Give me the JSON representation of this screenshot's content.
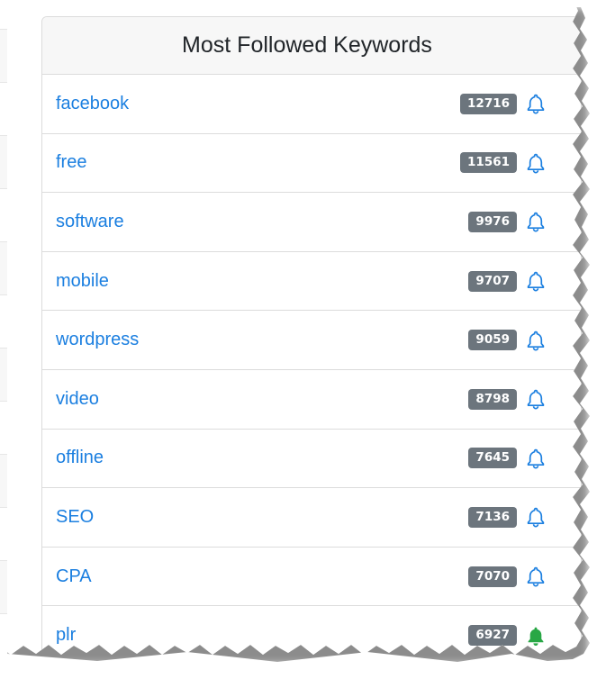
{
  "card": {
    "title": "Most Followed Keywords"
  },
  "keywords": [
    {
      "label": "facebook",
      "count": "12716",
      "bell_state": "outline",
      "bell_color": "#1b7fe0"
    },
    {
      "label": "free",
      "count": "11561",
      "bell_state": "outline",
      "bell_color": "#1b7fe0"
    },
    {
      "label": "software",
      "count": "9976",
      "bell_state": "outline",
      "bell_color": "#1b7fe0"
    },
    {
      "label": "mobile",
      "count": "9707",
      "bell_state": "outline",
      "bell_color": "#1b7fe0"
    },
    {
      "label": "wordpress",
      "count": "9059",
      "bell_state": "outline",
      "bell_color": "#1b7fe0"
    },
    {
      "label": "video",
      "count": "8798",
      "bell_state": "outline",
      "bell_color": "#1b7fe0"
    },
    {
      "label": "offline",
      "count": "7645",
      "bell_state": "outline",
      "bell_color": "#1b7fe0"
    },
    {
      "label": "SEO",
      "count": "7136",
      "bell_state": "outline",
      "bell_color": "#1b7fe0"
    },
    {
      "label": "CPA",
      "count": "7070",
      "bell_state": "outline",
      "bell_color": "#1b7fe0"
    },
    {
      "label": "plr",
      "count": "6927",
      "bell_state": "filled",
      "bell_color": "#28a745"
    }
  ],
  "icons": {
    "bell": "bell-icon"
  },
  "colors": {
    "link": "#1b7fe0",
    "badge_bg": "#6c757d",
    "badge_text": "#ffffff",
    "followed_bell": "#28a745",
    "header_bg": "#f7f7f7"
  }
}
